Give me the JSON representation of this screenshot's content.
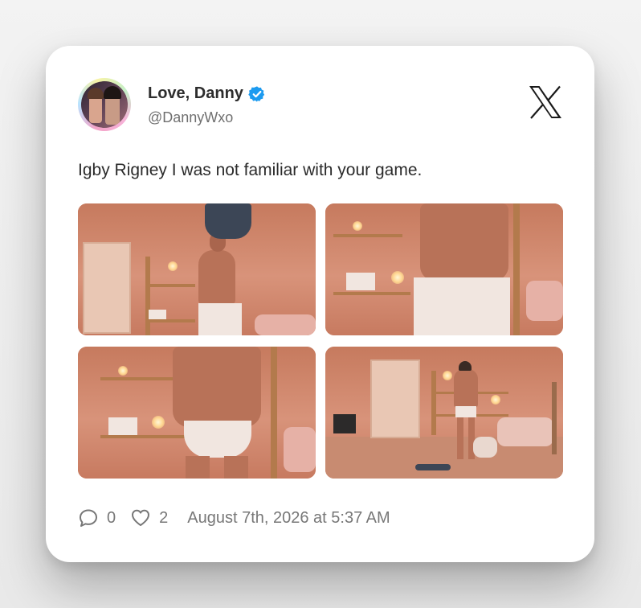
{
  "post": {
    "author_name": "Love, Danny",
    "author_handle": "@DannyWxo",
    "verified": true,
    "text": "Igby Rigney I was not familiar with your game.",
    "reply_count": "0",
    "like_count": "2",
    "timestamp": "August 7th, 2026 at 5:37 AM"
  },
  "icons": {
    "verified": "verified-badge-icon",
    "brand": "x-logo-icon",
    "reply": "comment-bubble-icon",
    "like": "heart-icon"
  },
  "colors": {
    "verified_blue": "#1d9bf0",
    "photo_tone": "#c98266"
  }
}
